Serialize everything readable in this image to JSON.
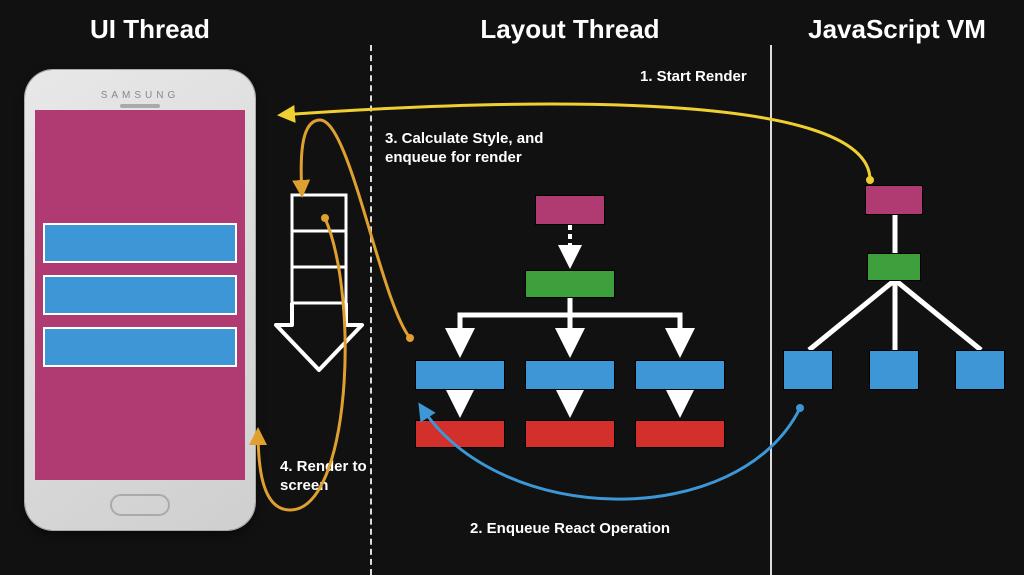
{
  "sections": {
    "ui": "UI Thread",
    "layout": "Layout Thread",
    "js": "JavaScript VM"
  },
  "phone": {
    "brand": "SAMSUNG"
  },
  "steps": {
    "s1": "1. Start Render",
    "s2": "2. Enqueue React Operation",
    "s3": "3. Calculate Style, and enqueue for render",
    "s4": "4. Render to screen"
  },
  "colors": {
    "pink": "#b03a72",
    "green": "#3ea03d",
    "blue": "#3d97d6",
    "red": "#d3302c",
    "yellow_arrow": "#f0d030",
    "orange_arrow": "#e0a030",
    "blue_arrow": "#3d97d6"
  },
  "diagram": {
    "layout_tree": {
      "root": "pink",
      "mid": "green",
      "leaves": [
        "blue",
        "blue",
        "blue"
      ],
      "render_leaves": [
        "red",
        "red",
        "red"
      ]
    },
    "js_tree": {
      "root": "pink",
      "mid": "green",
      "leaves": [
        "blue",
        "blue",
        "blue"
      ]
    }
  }
}
